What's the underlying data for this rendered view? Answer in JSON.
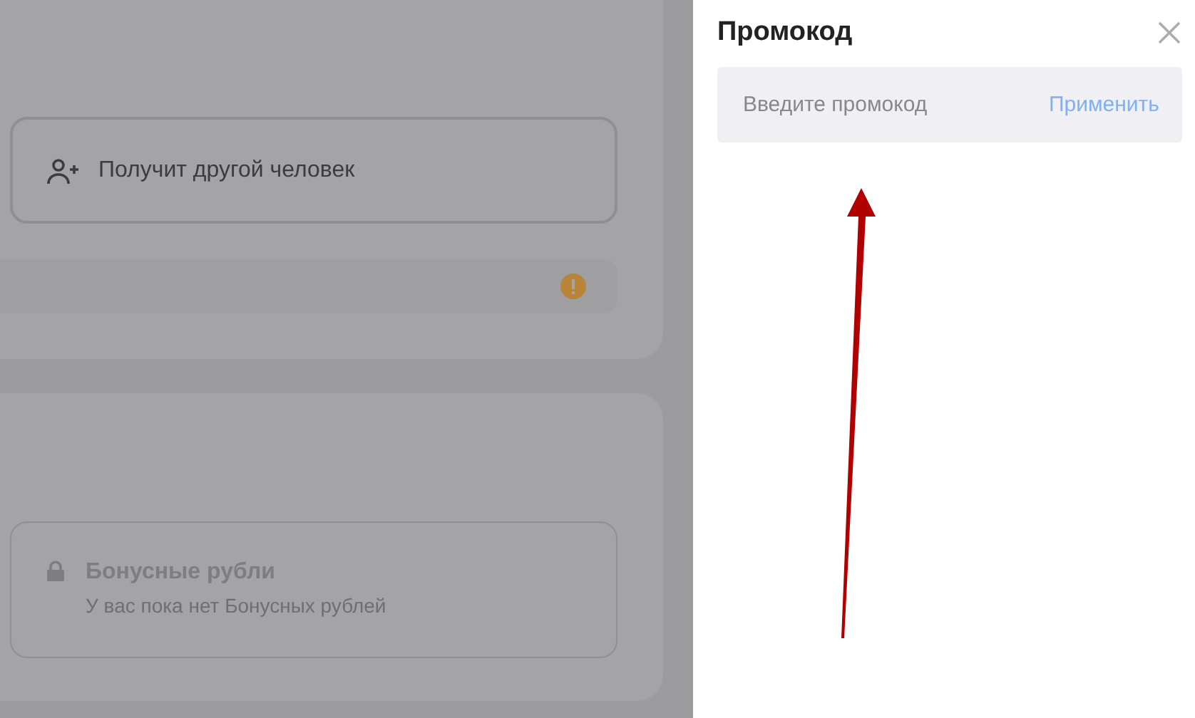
{
  "background_page": {
    "recipient_option": {
      "label": "Получит другой человек"
    },
    "bonus": {
      "title": "Бонусные рубли",
      "text": "У вас пока нет Бонусных рублей",
      "locked": true
    }
  },
  "promo_panel": {
    "title": "Промокод",
    "field": {
      "placeholder": "Введите промокод"
    },
    "apply_button": "Применить"
  }
}
